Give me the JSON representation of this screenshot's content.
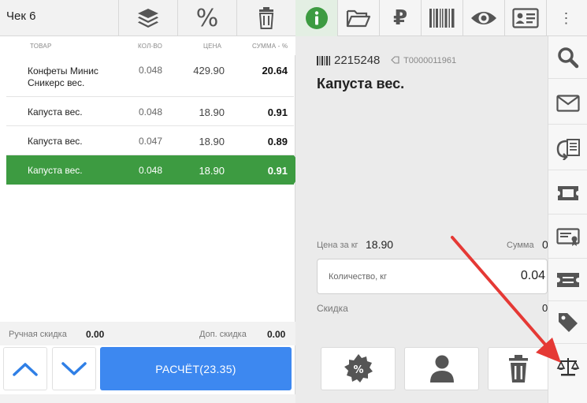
{
  "receipt": {
    "title": "Чек 6",
    "discount_button": "%"
  },
  "columns": {
    "item": "ТОВАР",
    "qty": "КОЛ-ВО",
    "price": "ЦЕНА",
    "sum": "СУММА - %"
  },
  "rows": [
    {
      "name": "Конфеты Минис Сникерс вес.",
      "qty": "0.048",
      "price": "429.90",
      "sum": "20.64",
      "selected": false
    },
    {
      "name": "Капуста вес.",
      "qty": "0.048",
      "price": "18.90",
      "sum": "0.91",
      "selected": false
    },
    {
      "name": "Капуста вес.",
      "qty": "0.047",
      "price": "18.90",
      "sum": "0.89",
      "selected": false
    },
    {
      "name": "Капуста вес.",
      "qty": "0.048",
      "price": "18.90",
      "sum": "0.91",
      "selected": true
    }
  ],
  "footer": {
    "manual_discount_label": "Ручная скидка",
    "manual_discount_value": "0.00",
    "extra_discount_label": "Доп. скидка",
    "extra_discount_value": "0.00",
    "pay_label": "РАСЧЁТ(23.35)"
  },
  "product": {
    "barcode": "2215248",
    "sku": "Т0000011961",
    "name": "Капуста вес.",
    "price_label": "Цена за кг",
    "price_value": "18.90",
    "sum_label": "Сумма",
    "sum_value": "0",
    "qty_label": "Количество, кг",
    "qty_value": "0.04",
    "discount_label": "Скидка",
    "discount_value": "0"
  },
  "top_tabs": [
    "info-icon",
    "folder-open-icon",
    "ruble-icon",
    "barcode-icon",
    "eye-icon",
    "id-card-icon",
    "more-vert-icon"
  ],
  "top_tab_ruble": "₽",
  "top_tab_more": "⋮",
  "sidebar_icons": [
    "search-icon",
    "envelope-icon",
    "return-receipt-icon",
    "ticket-icon",
    "certificate-card-icon",
    "coupon-icon",
    "tag-icon",
    "scales-icon"
  ],
  "colors": {
    "accent_green": "#3d9b41",
    "pay_blue": "#3d88f0",
    "annotation_red": "#e53935",
    "panel_gray": "#ebebeb"
  }
}
